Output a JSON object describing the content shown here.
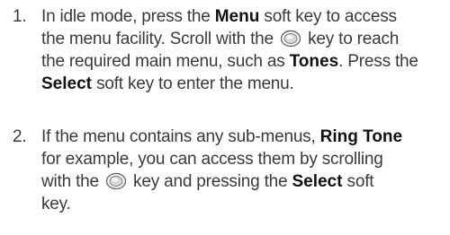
{
  "steps": [
    {
      "number": "1.",
      "lines": [
        [
          "In idle mode, press the ",
          "Menu",
          " soft key to access"
        ],
        [
          "the menu facility. Scroll with the ",
          "NAV",
          " key to reach"
        ],
        [
          "the required main menu, such as ",
          "Tones",
          ". Press the"
        ],
        [
          "",
          "Select",
          " soft key to enter the menu."
        ]
      ]
    },
    {
      "number": "2.",
      "lines": [
        [
          "If the menu contains any sub-menus, ",
          "Ring Tone",
          ""
        ],
        [
          "for example, you can access them by scrolling",
          "",
          ""
        ],
        [
          "with the ",
          "NAV",
          " key and pressing the ",
          "Select",
          " soft"
        ],
        [
          "key.",
          "",
          ""
        ]
      ]
    }
  ],
  "icons": {
    "navigation_key": "nav-key-icon"
  },
  "text": {
    "s1l1a": "In idle mode, press the ",
    "s1l1b": "Menu",
    "s1l1c": " soft key to access",
    "s1l2a": "the menu facility. Scroll with the ",
    "s1l2c": " key to reach",
    "s1l3a": "the required main menu, such as ",
    "s1l3b": "Tones",
    "s1l3c": ". Press the",
    "s1l4b": "Select",
    "s1l4c": " soft key to enter the menu.",
    "s2l1a": "If the menu contains any sub-menus, ",
    "s2l1b": "Ring Tone",
    "s2l2a": "for example, you can access them by scrolling",
    "s2l3a": "with the ",
    "s2l3c": " key and pressing the ",
    "s2l3d": "Select",
    "s2l3e": " soft",
    "s2l4a": "key."
  }
}
